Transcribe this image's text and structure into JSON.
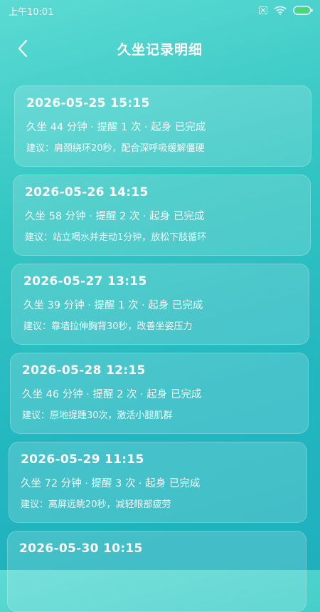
{
  "status_bar": {
    "time": "上午10:01",
    "icons": [
      "sim-off-icon",
      "wifi-icon",
      "battery-icon"
    ]
  },
  "header": {
    "back_icon": "chevron-left-icon",
    "title": "久坐记录明细"
  },
  "records": [
    {
      "date": "2026-05-25 15:15",
      "summary": "久坐 44 分钟 · 提醒 1 次 · 起身 已完成",
      "advice": "建议：肩颈绕环20秒，配合深呼吸缓解僵硬"
    },
    {
      "date": "2026-05-26 14:15",
      "summary": "久坐 58 分钟 · 提醒 2 次 · 起身 已完成",
      "advice": "建议：站立喝水并走动1分钟，放松下肢循环"
    },
    {
      "date": "2026-05-27 13:15",
      "summary": "久坐 39 分钟 · 提醒 1 次 · 起身 已完成",
      "advice": "建议：靠墙拉伸胸背30秒，改善坐姿压力"
    },
    {
      "date": "2026-05-28 12:15",
      "summary": "久坐 46 分钟 · 提醒 2 次 · 起身 已完成",
      "advice": "建议：原地提踵30次，激活小腿肌群"
    },
    {
      "date": "2026-05-29 11:15",
      "summary": "久坐 72 分钟 · 提醒 3 次 · 起身 已完成",
      "advice": "建议：离屏远眺20秒，减轻眼部疲劳"
    },
    {
      "date": "2026-05-30 10:15",
      "summary": "",
      "advice": ""
    }
  ]
}
